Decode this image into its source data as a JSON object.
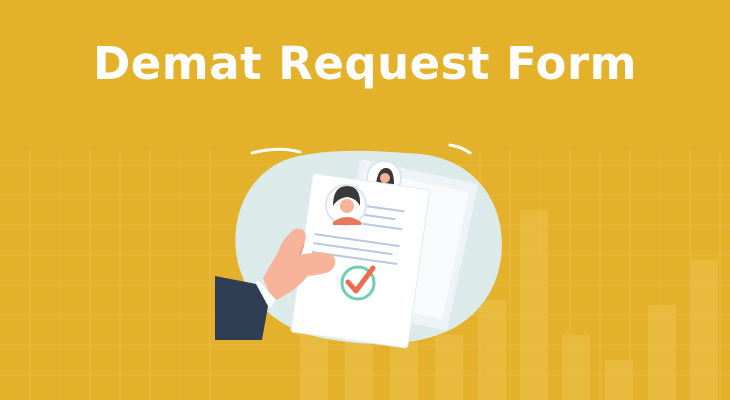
{
  "banner": {
    "title": "Demat Request Form"
  },
  "colors": {
    "background": "#E4B12A",
    "grid_line": "#EDC65C",
    "bar_fill": "#EBC04C",
    "blob": "#DCEBEA",
    "paper": "#FFFFFF",
    "paper_line": "#B8C8E0",
    "skin": "#F7B49B",
    "sleeve": "#2F3E52",
    "avatar_hair": "#3A3A3A",
    "avatar_shirt": "#E9785A",
    "check_circle": "#6FCFB2",
    "check_mark": "#EE6C4D"
  },
  "icons": {
    "illustration": "document-form-in-hand-icon",
    "check": "checkmark-icon",
    "avatar": "person-avatar-icon"
  }
}
